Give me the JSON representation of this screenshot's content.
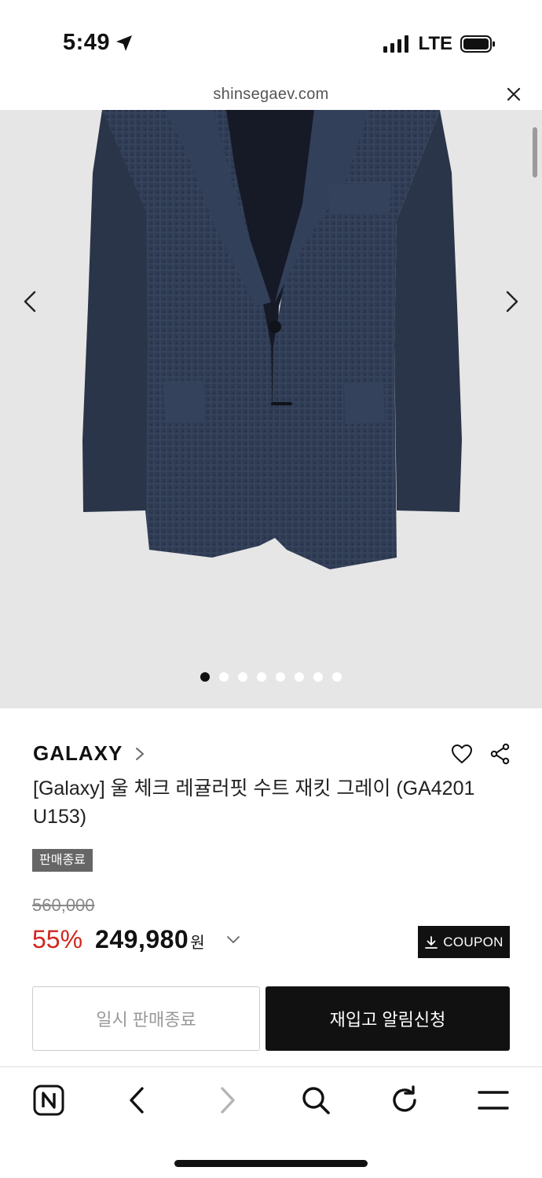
{
  "status_bar": {
    "time": "5:49",
    "network": "LTE"
  },
  "browser": {
    "url": "shinsegaev.com"
  },
  "gallery": {
    "image_count": 8,
    "active_index": 0
  },
  "product": {
    "brand": "GALAXY",
    "title": "[Galaxy] 울 체크 레귤러핏 수트 재킷 그레이 (GA4201 U153)",
    "status_badge": "판매종료",
    "original_price": "560,000",
    "discount": "55%",
    "price": "249,980",
    "currency": "원",
    "coupon_label": "COUPON"
  },
  "buttons": {
    "secondary": "일시 판매종료",
    "primary": "재입고 알림신청"
  },
  "colors": {
    "discount": "#d1261e",
    "primary_button": "#111111",
    "hero_bg": "#e6e6e6"
  }
}
